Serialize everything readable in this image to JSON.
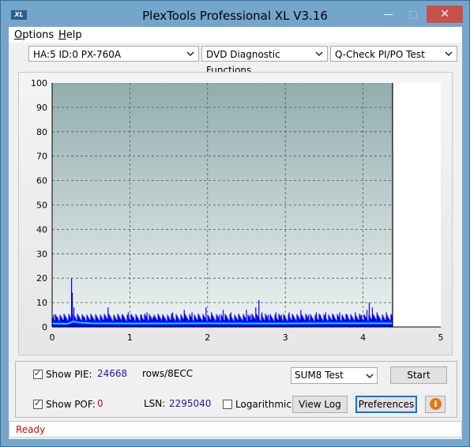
{
  "window": {
    "title": "PlexTools Professional XL V3.16",
    "logo_text": "XL",
    "minimize": "—",
    "maximize": "□",
    "close": "✕"
  },
  "menu": {
    "items": [
      {
        "label": "Options",
        "mnemonic": "O"
      },
      {
        "label": "Help",
        "mnemonic": "H"
      }
    ]
  },
  "toolbar": {
    "drive": "HA:5 ID:0  PX-760A",
    "function": "DVD Diagnostic Functions",
    "test": "Q-Check PI/PO Test"
  },
  "chart_data": {
    "type": "bar",
    "x_ticks": [
      "0",
      "1",
      "2",
      "3",
      "4",
      "5"
    ],
    "y_ticks": [
      "0",
      "10",
      "20",
      "30",
      "40",
      "50",
      "60",
      "70",
      "80",
      "90",
      "100"
    ],
    "xlim": [
      0,
      5
    ],
    "ylim": [
      0,
      100
    ],
    "grid": true,
    "end_marker_x": 4.38,
    "series": [
      {
        "type": "bar",
        "color": "#0000ff",
        "spikes": [
          [
            0.02,
            5
          ],
          [
            0.07,
            4
          ],
          [
            0.12,
            3
          ],
          [
            0.18,
            4
          ],
          [
            0.22,
            5
          ],
          [
            0.25,
            20
          ],
          [
            0.26,
            14
          ],
          [
            0.28,
            8
          ],
          [
            0.3,
            4
          ],
          [
            0.35,
            3
          ],
          [
            0.42,
            4
          ],
          [
            0.5,
            3
          ],
          [
            0.6,
            3
          ],
          [
            0.72,
            8
          ],
          [
            0.8,
            4
          ],
          [
            0.9,
            5
          ],
          [
            0.98,
            6
          ],
          [
            1.05,
            4
          ],
          [
            1.15,
            5
          ],
          [
            1.22,
            6
          ],
          [
            1.3,
            4
          ],
          [
            1.42,
            4
          ],
          [
            1.55,
            6
          ],
          [
            1.66,
            5
          ],
          [
            1.7,
            7
          ],
          [
            1.8,
            6
          ],
          [
            1.88,
            5
          ],
          [
            1.98,
            8
          ],
          [
            2.05,
            6
          ],
          [
            2.15,
            5
          ],
          [
            2.2,
            7
          ],
          [
            2.3,
            6
          ],
          [
            2.4,
            5
          ],
          [
            2.5,
            7
          ],
          [
            2.55,
            5
          ],
          [
            2.62,
            8
          ],
          [
            2.66,
            11
          ],
          [
            2.7,
            6
          ],
          [
            2.78,
            5
          ],
          [
            2.88,
            6
          ],
          [
            2.95,
            5
          ],
          [
            3.05,
            6
          ],
          [
            3.15,
            5
          ],
          [
            3.2,
            7
          ],
          [
            3.3,
            5
          ],
          [
            3.4,
            6
          ],
          [
            3.45,
            5
          ],
          [
            3.52,
            6
          ],
          [
            3.62,
            5
          ],
          [
            3.7,
            6
          ],
          [
            3.8,
            5
          ],
          [
            3.9,
            6
          ],
          [
            3.98,
            5
          ],
          [
            4.05,
            7
          ],
          [
            4.08,
            10
          ],
          [
            4.12,
            8
          ],
          [
            4.18,
            6
          ],
          [
            4.25,
            5
          ],
          [
            4.3,
            6
          ],
          [
            4.36,
            5
          ]
        ],
        "baseline": 2.5
      },
      {
        "type": "line",
        "color": "#00e5ff",
        "points": [
          [
            0.0,
            1.4
          ],
          [
            0.2,
            1.3
          ],
          [
            0.27,
            2.2
          ],
          [
            0.35,
            1.8
          ],
          [
            0.5,
            1.5
          ],
          [
            1.0,
            1.4
          ],
          [
            1.5,
            1.4
          ],
          [
            2.0,
            1.5
          ],
          [
            2.5,
            1.4
          ],
          [
            3.0,
            1.4
          ],
          [
            3.5,
            1.5
          ],
          [
            4.0,
            1.5
          ],
          [
            4.38,
            1.5
          ]
        ]
      }
    ]
  },
  "controls": {
    "show_pie_label": "Show PIE:",
    "pie_value": "24668",
    "pie_unit": "rows/8ECC",
    "show_pof_label": "Show POF:",
    "pof_value": "0",
    "lsn_label": "LSN:",
    "lsn_value": "2295040",
    "logarithmic_label": "Logarithmic",
    "sum_test": "SUM8 Test",
    "start_button": "Start",
    "view_log_button": "View Log",
    "preferences_button": "Preferences",
    "info_glyph": "i"
  },
  "status": {
    "text": "Ready"
  }
}
